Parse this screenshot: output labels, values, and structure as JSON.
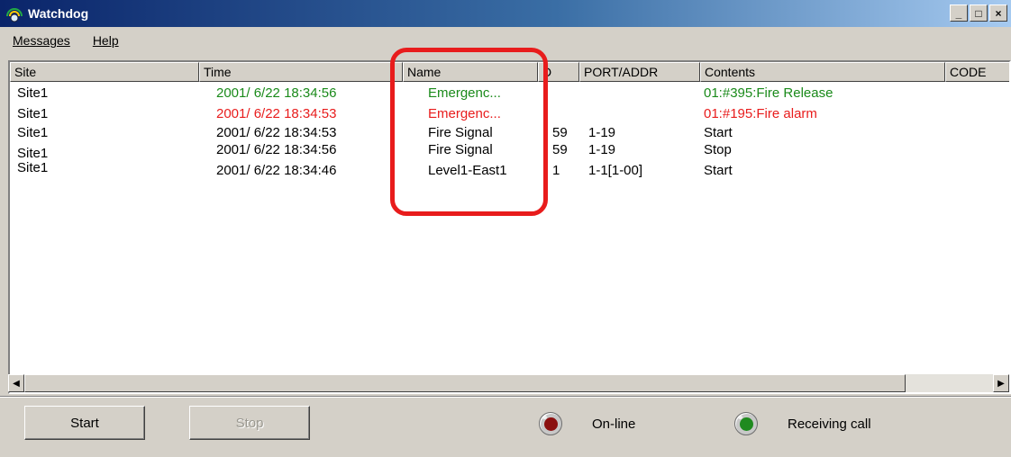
{
  "window": {
    "title": "Watchdog",
    "controls": [
      "_",
      "□",
      "×"
    ]
  },
  "menu": [
    {
      "label": "Messages"
    },
    {
      "label": "Help"
    }
  ],
  "table": {
    "columns": [
      "Site",
      "Time",
      "Name",
      "D",
      "PORT/ADDR",
      "Contents",
      "CODE"
    ],
    "rows": [
      {
        "site": "Site1",
        "time": "2001/ 6/22  18:34:56",
        "name": "Emergenc...",
        "id": "",
        "port": "",
        "contents": "01:#395:Fire Release",
        "color": "#1a8a1a"
      },
      {
        "site": "Site1",
        "time": "2001/ 6/22  18:34:53",
        "name": "Emergenc...",
        "id": "",
        "port": "",
        "contents": "01:#195:Fire alarm",
        "color": "#e81c1c"
      },
      {
        "site": "Site1",
        "time": "2001/ 6/22  18:34:53",
        "name": "Fire Signal",
        "id": "59",
        "port": "1-19",
        "contents": "Start",
        "color": "#000000"
      },
      {
        "site": "Site1",
        "time": "2001/ 6/22  18:34:56",
        "name": "Fire Signal",
        "id": "59",
        "port": "1-19",
        "contents": "Stop",
        "color": "#000000"
      },
      {
        "site": "Site1",
        "time": "2001/ 6/22  18:34:46",
        "name": "Level1-East1",
        "id": "1",
        "port": "1-1[1-00]",
        "contents": "Start",
        "color": "#000000"
      }
    ]
  },
  "buttons": {
    "start": "Start",
    "stop": "Stop"
  },
  "status": {
    "online": {
      "label": "On-line",
      "color": "#8b1010"
    },
    "receiving": {
      "label": "Receiving call",
      "color": "#1f8a1f"
    }
  },
  "colors": {
    "highlight": "#e81c1c",
    "titlebar": "#0a246a"
  }
}
